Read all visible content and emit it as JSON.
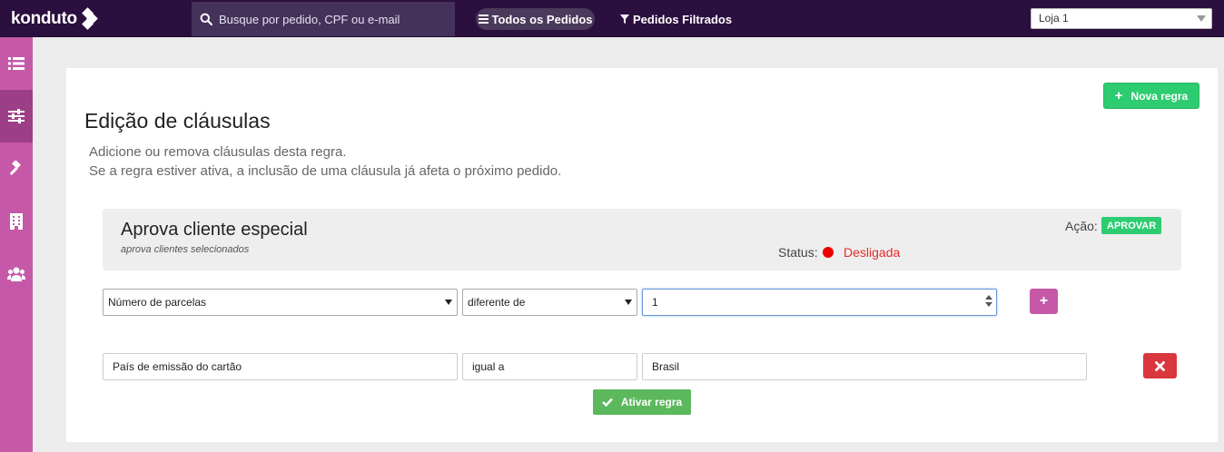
{
  "header": {
    "logo_text": "konduto",
    "search_placeholder": "Busque por pedido, CPF ou e-mail",
    "nav_all_orders": "Todos os Pedidos",
    "nav_filtered_orders": "Pedidos Filtrados",
    "store_selected": "Loja 1"
  },
  "sidebar": {
    "items": [
      {
        "icon": "list-icon"
      },
      {
        "icon": "sliders-icon",
        "active": true
      },
      {
        "icon": "gavel-icon"
      },
      {
        "icon": "building-icon"
      },
      {
        "icon": "users-icon"
      }
    ]
  },
  "page": {
    "new_rule_label": "Nova regra",
    "title": "Edição de cláusulas",
    "desc_line1": "Adicione ou remova cláusulas desta regra.",
    "desc_line2": "Se a regra estiver ativa, a inclusão de uma cláusula já afeta o próximo pedido."
  },
  "rule": {
    "name": "Aprova cliente especial",
    "description": "aprova clientes selecionados",
    "action_label": "Ação:",
    "action_value": "APROVAR",
    "status_label": "Status:",
    "status_value": "Desligada"
  },
  "new_clause": {
    "field": "Número de parcelas",
    "operator": "diferente de",
    "value": "1"
  },
  "clauses": [
    {
      "field": "País de emissão do cartão",
      "operator": "igual a",
      "value": "Brasil"
    }
  ],
  "activate_label": "Ativar regra",
  "colors": {
    "topbar": "#2b0f3f",
    "sidebar": "#c559a8",
    "green": "#2ecc71",
    "danger": "#d9363e",
    "status_off": "#e52c2c"
  }
}
